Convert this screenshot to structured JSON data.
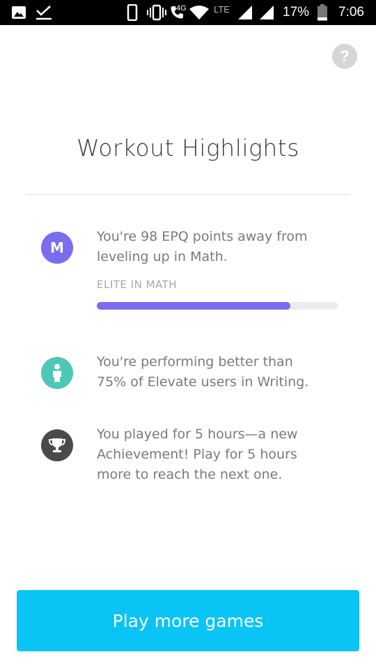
{
  "status_bar": {
    "network_label": "4G",
    "lte_label": "LTE",
    "battery_percent": "17%",
    "time": "7:06",
    "icons": [
      "image-icon",
      "check-icon",
      "phone-icon",
      "vibrate-icon",
      "call-icon",
      "wifi-icon",
      "signal-icon",
      "battery-icon"
    ]
  },
  "header": {
    "help_label": "?",
    "title": "Workout Highlights"
  },
  "highlights": [
    {
      "icon": "math-badge-icon",
      "icon_text": "M",
      "icon_color": "#7b6cf0",
      "text": "You're 98 EPQ points away from\nleveling up in Math.",
      "sub_label": "ELITE IN MATH",
      "progress_fraction": 0.8
    },
    {
      "icon": "person-icon",
      "icon_color": "#4ec7b5",
      "text": "You're performing better than\n75% of Elevate users in Writing."
    },
    {
      "icon": "trophy-icon",
      "icon_color": "#4a4a4a",
      "text": "You played for 5 hours—a new\nAchievement! Play for 5 hours\nmore to reach the next one."
    }
  ],
  "cta": {
    "label": "Play more games",
    "color": "#09c4f5"
  }
}
